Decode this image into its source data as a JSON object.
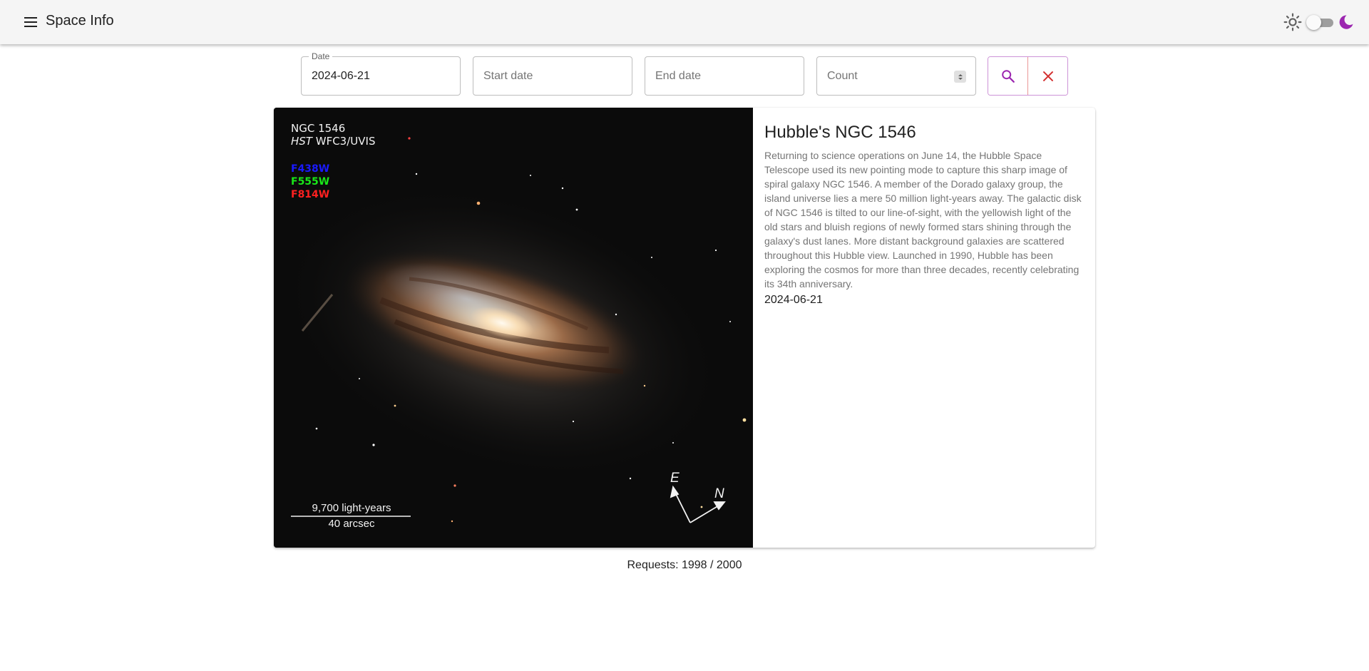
{
  "app": {
    "title": "Space Info"
  },
  "theme": {
    "light_icon": "sun-icon",
    "dark_icon": "moon-icon",
    "mode": "light",
    "accent": "#9c27b0"
  },
  "search": {
    "date": {
      "label": "Date",
      "value": "2024-06-21"
    },
    "start_date": {
      "placeholder": "Start date"
    },
    "end_date": {
      "placeholder": "End date"
    },
    "count": {
      "placeholder": "Count"
    },
    "search_icon": "search-icon",
    "clear_icon": "close-icon"
  },
  "apod": {
    "title": "Hubble's NGC 1546",
    "explanation": "Returning to science operations on June 14, the Hubble Space Telescope used its new pointing mode to capture this sharp image of spiral galaxy NGC 1546. A member of the Dorado galaxy group, the island universe lies a mere 50 million light-years away. The galactic disk of NGC 1546 is tilted to our line-of-sight, with the yellowish light of the old stars and bluish regions of newly formed stars shining through the galaxy's dust lanes. More distant background galaxies are scattered throughout this Hubble view. Launched in 1990, Hubble has been exploring the cosmos for more than three decades, recently celebrating its 34th anniversary.",
    "date": "2024-06-21",
    "image": {
      "object": "NGC 1546",
      "instrument_prefix": "HST",
      "instrument": "WFC3/UVIS",
      "filters": [
        {
          "name": "F438W",
          "color": "#1a1aff"
        },
        {
          "name": "F555W",
          "color": "#19e619"
        },
        {
          "name": "F814W",
          "color": "#ff2020"
        }
      ],
      "scale_top": "9,700 light-years",
      "scale_bottom": "40 arcsec",
      "compass_e": "E",
      "compass_n": "N"
    }
  },
  "footer": {
    "requests": "Requests: 1998 / 2000"
  }
}
